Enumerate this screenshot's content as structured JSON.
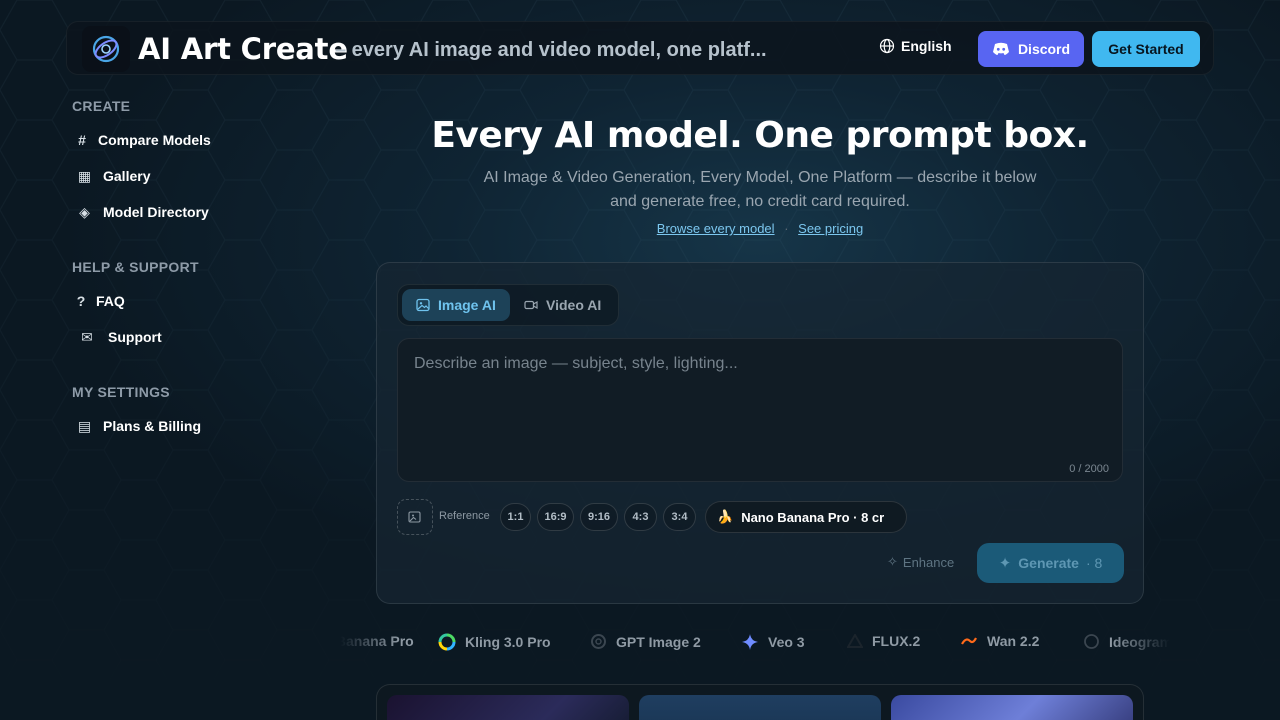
{
  "header": {
    "brand": "AI Art Create",
    "tagline": "– every AI image and video model, one platf...",
    "language": "English",
    "discord_label": "Discord",
    "get_started_label": "Get Started"
  },
  "sidebar": {
    "sections": [
      {
        "title": "CREATE",
        "items": [
          {
            "label": "Compare Models",
            "icon": "hash-icon"
          },
          {
            "label": "Gallery",
            "icon": "grid-icon"
          },
          {
            "label": "Model Directory",
            "icon": "diamond-icon"
          }
        ]
      },
      {
        "title": "HELP & SUPPORT",
        "items": [
          {
            "label": "FAQ",
            "icon": "question-icon"
          },
          {
            "label": "Support",
            "icon": "envelope-icon"
          }
        ]
      },
      {
        "title": "MY SETTINGS",
        "items": [
          {
            "label": "Plans & Billing",
            "icon": "list-icon"
          }
        ]
      }
    ]
  },
  "hero": {
    "title": "Every AI model. One prompt box.",
    "subtitle": "AI Image & Video Generation, Every Model, One Platform — describe it below and generate free, no credit card required.",
    "link_browse": "Browse every model",
    "link_separator": "·",
    "link_pricing": "See pricing"
  },
  "composer": {
    "tabs": [
      {
        "label": "Image AI",
        "active": true
      },
      {
        "label": "Video AI",
        "active": false
      }
    ],
    "prompt_placeholder": "Describe an image — subject, style, lighting...",
    "prompt_value": "",
    "char_counter": "0 / 2000",
    "reference_label": "Reference",
    "aspect_ratios": [
      "1:1",
      "16:9",
      "9:16",
      "4:3",
      "3:4"
    ],
    "model_emoji": "🍌",
    "model_label": "Nano Banana Pro · 8 cr",
    "enhance_label": "Enhance",
    "generate_label": "Generate",
    "generate_cost": "· 8"
  },
  "models_marquee": [
    {
      "label": "Nano Banana Pro",
      "icon": "banana-icon"
    },
    {
      "label": "Kling 3.0 Pro",
      "icon": "kling-icon"
    },
    {
      "label": "GPT Image 2",
      "icon": "openai-icon"
    },
    {
      "label": "Veo 3",
      "icon": "gemini-spark-icon"
    },
    {
      "label": "FLUX.2",
      "icon": "flux-triangle-icon"
    },
    {
      "label": "Wan 2.2",
      "icon": "wan-icon"
    },
    {
      "label": "Ideogram",
      "icon": "ideogram-icon"
    }
  ],
  "colors": {
    "accent": "#40b8f0",
    "discord": "#5865f2",
    "tab_active_bg": "#1d4258",
    "tab_active_text": "#6fc3ee",
    "generate_bg": "#1b5a78",
    "link": "#7cc7ef"
  }
}
